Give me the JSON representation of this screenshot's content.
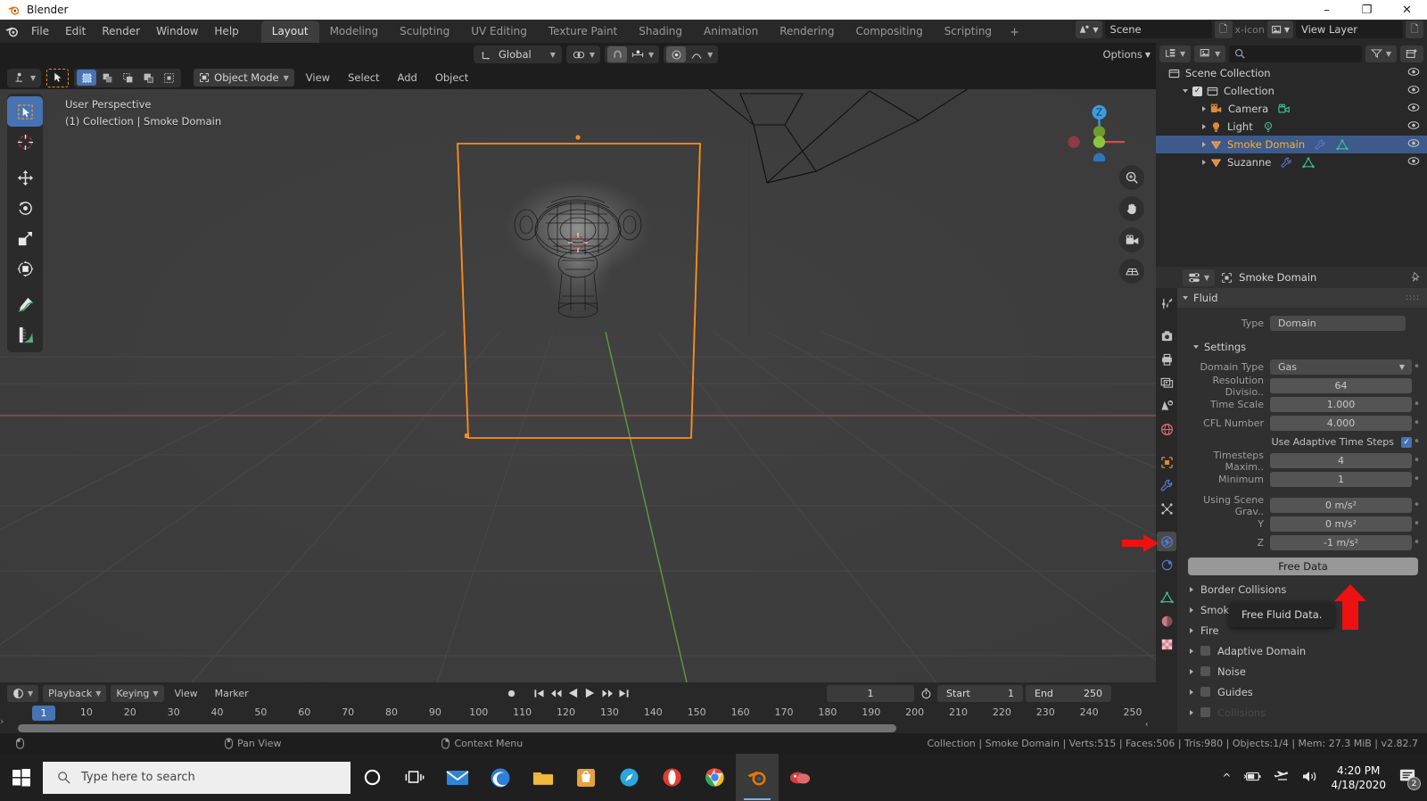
{
  "window": {
    "title": "Blender",
    "controls": [
      "–",
      "❐",
      "✕"
    ]
  },
  "topbar": {
    "menus": [
      "File",
      "Edit",
      "Render",
      "Window",
      "Help"
    ],
    "workspace_tabs": [
      "Layout",
      "Modeling",
      "Sculpting",
      "UV Editing",
      "Texture Paint",
      "Shading",
      "Animation",
      "Rendering",
      "Compositing",
      "Scripting"
    ],
    "active_tab": "Layout",
    "add_tab": "+",
    "scene_name": "Scene",
    "view_layer_name": "View Layer",
    "scene_icon": "scene-icon",
    "view_layer_icon": "view-layer-icon",
    "copy_icon": "copy-icon",
    "close_icon": "x-icon"
  },
  "viewport_header": {
    "orientation": "Global",
    "orientation_icon": "transform-orientation-icon",
    "pivot_icon": "pivot-point-icon",
    "snap_magnet_icon": "snap-magnet-icon",
    "snap_increment_icon": "snap-increment-icon",
    "proportional_icon": "proportional-edit-icon",
    "falloff_icon": "falloff-curve-icon",
    "options_label": "Options",
    "visibility_icon": "object-visibility-icon",
    "gizmo_icon": "gizmo-icon",
    "overlays_icon": "overlays-icon",
    "xray_icon": "xray-icon",
    "shading_wireframe_icon": "shading-wireframe-icon",
    "shading_solid_icon": "shading-solid-icon",
    "shading_material_icon": "shading-material-icon",
    "shading_rendered_icon": "shading-rendered-icon"
  },
  "viewport_tool_header": {
    "mode": "Object Mode",
    "mode_icon": "object-mode-icon",
    "menus": [
      "View",
      "Select",
      "Add",
      "Object"
    ],
    "cursor_tool_icon": "tweak-cursor-icon",
    "select_box_icon": "select-box-icon",
    "select_modes": [
      "select-set-icon",
      "select-extend-icon",
      "select-subtract-icon",
      "select-invert-icon",
      "select-intersect-icon"
    ]
  },
  "viewport": {
    "overlay_line1": "User Perspective",
    "overlay_line2": "(1) Collection | Smoke Domain",
    "left_tools": [
      {
        "name": "tweak-tool",
        "icon": "cursor-arrow-icon",
        "active": true
      },
      {
        "name": "cursor-tool",
        "icon": "3d-cursor-icon",
        "active": false
      },
      {
        "name": "move-tool",
        "icon": "move-arrows-icon",
        "active": false
      },
      {
        "name": "rotate-tool",
        "icon": "rotate-icon",
        "active": false
      },
      {
        "name": "scale-tool",
        "icon": "scale-icon",
        "active": false
      },
      {
        "name": "transform-tool",
        "icon": "transform-icon",
        "active": false
      },
      {
        "name": "annotate-tool",
        "icon": "annotate-pencil-icon",
        "active": false
      },
      {
        "name": "measure-tool",
        "icon": "measure-ruler-icon",
        "active": false
      }
    ],
    "right_tools": [
      {
        "name": "zoom-tool",
        "icon": "magnifier-icon"
      },
      {
        "name": "pan-tool",
        "icon": "hand-icon"
      },
      {
        "name": "camera-view-tool",
        "icon": "camera-icon"
      },
      {
        "name": "toggle-perspective-tool",
        "icon": "grid-perspective-icon"
      }
    ],
    "gizmo_axes": [
      "X",
      "Y",
      "Z"
    ]
  },
  "outliner": {
    "display_mode_icon": "outliner-display-mode-icon",
    "filter_icon": "filter-icon",
    "new_collection_icon": "new-collection-icon",
    "search_placeholder": "",
    "search_icon": "search-icon",
    "rows": [
      {
        "label": "Scene Collection",
        "icon": "collection-icon",
        "indent": 14,
        "selected": false,
        "expand": "",
        "checkbox": false,
        "extras": []
      },
      {
        "label": "Collection",
        "icon": "collection-icon",
        "indent": 30,
        "selected": false,
        "expand": "down",
        "checkbox": true,
        "extras": []
      },
      {
        "label": "Camera",
        "icon": "camera-obj-icon",
        "indent": 52,
        "selected": false,
        "expand": "right",
        "checkbox": false,
        "extras": [
          "camera-data-icon"
        ]
      },
      {
        "label": "Light",
        "icon": "light-obj-icon",
        "indent": 52,
        "selected": false,
        "expand": "right",
        "checkbox": false,
        "extras": [
          "light-data-icon"
        ]
      },
      {
        "label": "Smoke Domain",
        "icon": "mesh-obj-icon",
        "indent": 52,
        "selected": true,
        "expand": "right",
        "checkbox": false,
        "extras": [
          "modifier-wrench-icon",
          "mesh-data-icon"
        ]
      },
      {
        "label": "Suzanne",
        "icon": "mesh-obj-icon",
        "indent": 52,
        "selected": false,
        "expand": "right",
        "checkbox": false,
        "extras": [
          "modifier-wrench-icon",
          "mesh-data-icon"
        ]
      }
    ],
    "eye_icon": "eye-icon"
  },
  "properties": {
    "breadcrumb": "Smoke Domain",
    "breadcrumb_icon": "object-icon",
    "editor_type_icon": "properties-editor-icon",
    "pin_icon": "pin-icon",
    "grip_icon": "grip-dots-icon",
    "tabs": [
      {
        "name": "tool-tab",
        "icon": "tool-icon",
        "active": false
      },
      {
        "name": "render-tab",
        "icon": "render-camera-icon",
        "active": false
      },
      {
        "name": "output-tab",
        "icon": "printer-icon",
        "active": false
      },
      {
        "name": "view-layer-tab",
        "icon": "images-icon",
        "active": false
      },
      {
        "name": "scene-tab",
        "icon": "scene-cone-icon",
        "active": false
      },
      {
        "name": "world-tab",
        "icon": "world-globe-icon",
        "active": false
      },
      {
        "name": "object-tab",
        "icon": "object-square-icon",
        "active": false
      },
      {
        "name": "modifier-tab",
        "icon": "wrench-icon",
        "active": false
      },
      {
        "name": "particles-tab",
        "icon": "particles-icon",
        "active": false
      },
      {
        "name": "physics-tab",
        "icon": "physics-orbit-icon",
        "active": true
      },
      {
        "name": "constraints-tab",
        "icon": "constraint-icon",
        "active": false
      },
      {
        "name": "data-tab",
        "icon": "mesh-data-triangle-icon",
        "active": false
      },
      {
        "name": "material-tab",
        "icon": "material-sphere-icon",
        "active": false
      },
      {
        "name": "texture-tab",
        "icon": "checker-texture-icon",
        "active": false
      }
    ],
    "fluid_panel": "Fluid",
    "type_label": "Type",
    "type_value": "Domain",
    "settings_panel": "Settings",
    "fields": [
      {
        "label": "Domain Type",
        "value": "Gas",
        "kind": "dropdown",
        "dot": true
      },
      {
        "label": "Resolution Divisio..",
        "value": "64",
        "kind": "number",
        "dot": false
      },
      {
        "label": "Time Scale",
        "value": "1.000",
        "kind": "number",
        "dot": true
      },
      {
        "label": "CFL Number",
        "value": "4.000",
        "kind": "number",
        "dot": true
      }
    ],
    "adaptive_steps_label": "Use Adaptive Time Steps",
    "adaptive_steps_checked": true,
    "fields2": [
      {
        "label": "Timesteps Maxim..",
        "value": "4",
        "kind": "number",
        "dot": true
      },
      {
        "label": "Minimum",
        "value": "1",
        "kind": "number",
        "dot": true
      }
    ],
    "gravity": [
      {
        "label": "Using Scene Grav..",
        "value": "0 m/s²",
        "dot": true
      },
      {
        "label": "Y",
        "value": "0 m/s²",
        "dot": true
      },
      {
        "label": "Z",
        "value": "-1 m/s²",
        "dot": true
      }
    ],
    "free_data_button": "Free Data",
    "tooltip_text": "Free Fluid Data.",
    "collapsed_panels": [
      {
        "label": "Border Collisions",
        "checkbox": false
      },
      {
        "label": "Smoke",
        "checkbox": false
      },
      {
        "label": "Fire",
        "checkbox": false
      },
      {
        "label": "Adaptive Domain",
        "checkbox": true
      },
      {
        "label": "Noise",
        "checkbox": true
      },
      {
        "label": "Guides",
        "checkbox": true
      }
    ]
  },
  "timeline": {
    "editor_icon": "timeline-editor-icon",
    "menus": [
      "Playback",
      "Keying",
      "View",
      "Marker"
    ],
    "playback_label": "Playback",
    "keying_label": "Keying",
    "transport_icons": [
      "record-icon",
      "jump-start-icon",
      "prev-keyframe-icon",
      "play-reverse-icon",
      "play-icon",
      "next-keyframe-icon",
      "jump-end-icon"
    ],
    "current_frame": "1",
    "clock_icon": "stopwatch-icon",
    "start_label": "Start",
    "start_value": "1",
    "end_label": "End",
    "end_value": "250",
    "ticks": [
      "1",
      "10",
      "20",
      "30",
      "40",
      "50",
      "60",
      "70",
      "80",
      "90",
      "100",
      "110",
      "120",
      "130",
      "140",
      "150",
      "160",
      "170",
      "180",
      "190",
      "200",
      "210",
      "220",
      "230",
      "240",
      "250"
    ]
  },
  "statusbar": {
    "mouse_hints": [
      {
        "icon": "mouse-left-icon",
        "label": ""
      },
      {
        "icon": "mouse-middle-icon",
        "label": "Pan View"
      },
      {
        "icon": "mouse-right-icon",
        "label": "Context Menu"
      }
    ],
    "stats": "Collection | Smoke Domain | Verts:515 | Faces:506 | Tris:980 | Objects:1/4 | Mem: 27.3 MiB | v2.82.7"
  },
  "taskbar": {
    "search_placeholder": "Type here to search",
    "search_icon": "search-icon",
    "start_icon": "windows-start-icon",
    "apps": [
      {
        "name": "cortana-icon",
        "color": "#ffffff"
      },
      {
        "name": "task-view-icon",
        "color": "#ffffff"
      },
      {
        "name": "mail-icon",
        "color": "#1b7ed6"
      },
      {
        "name": "edge-icon",
        "color": "#2b7cd3"
      },
      {
        "name": "file-explorer-icon",
        "color": "#f3c34a"
      },
      {
        "name": "store-icon",
        "color": "#e8a33d"
      },
      {
        "name": "compass-icon",
        "color": "#2aa3dd"
      },
      {
        "name": "opera-icon",
        "color": "#e8342b"
      },
      {
        "name": "chrome-icon",
        "color": "#4285f4"
      },
      {
        "name": "blender-icon",
        "color": "#ea7600"
      },
      {
        "name": "other-app-icon",
        "color": "#d63c3c"
      }
    ],
    "tray_icons": [
      "chevron-up-icon",
      "battery-icon",
      "airplane-icon",
      "volume-icon"
    ],
    "time": "4:20 PM",
    "date": "4/18/2020",
    "notification_count": "2"
  },
  "colors": {
    "accent_blue": "#4772b3",
    "orange_select": "#ff8c19",
    "red_arrow": "#ee1111",
    "bg_dark": "#1d1d1d",
    "bg_panel": "#303030",
    "viewport_bg": "#3d3d3d"
  }
}
